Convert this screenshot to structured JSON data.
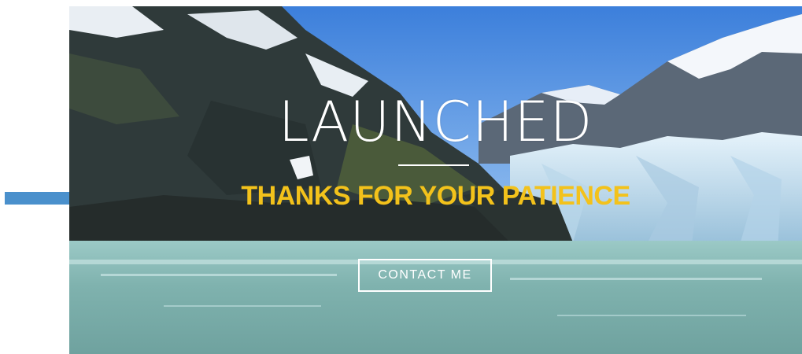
{
  "hero": {
    "title": "LAUNCHED",
    "subtitle": "THANKS FOR YOUR PATIENCE",
    "cta_label": "CONTACT ME"
  },
  "colors": {
    "subtitle": "#f3c21b",
    "arrow": "#4a90cc",
    "title": "#ffffff",
    "water": "#7fb3b1",
    "sky": "#3f86df",
    "glacier": "#cfe7f6"
  },
  "icons": {
    "annotation": "right-arrow-icon"
  }
}
